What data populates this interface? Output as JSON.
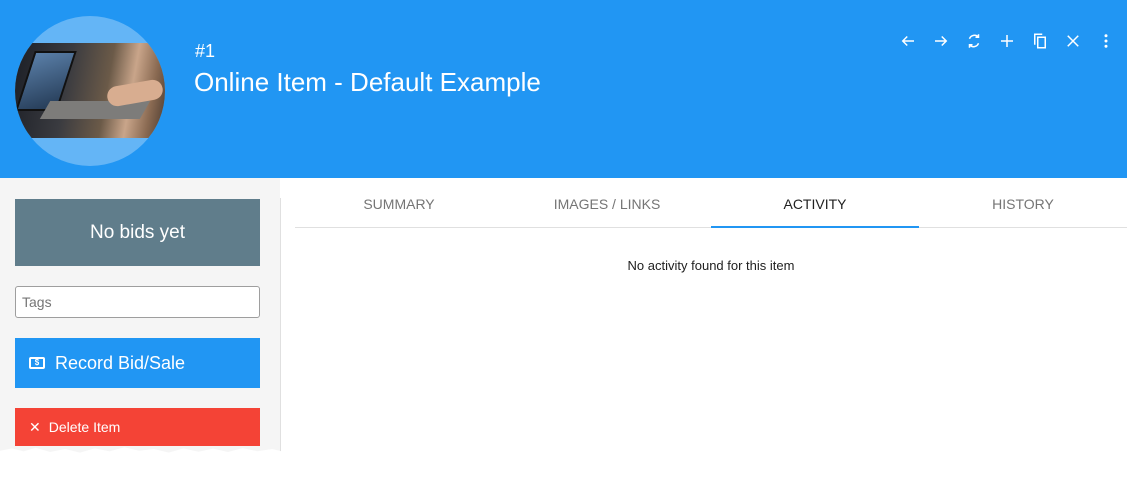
{
  "header": {
    "item_number": "#1",
    "title": "Online Item - Default Example",
    "background_color": "#2196F3",
    "actions": [
      {
        "icon": "arrow-left-icon"
      },
      {
        "icon": "arrow-right-icon"
      },
      {
        "icon": "refresh-icon"
      },
      {
        "icon": "add-icon"
      },
      {
        "icon": "copy-icon"
      },
      {
        "icon": "close-icon"
      },
      {
        "icon": "more-vert-icon"
      }
    ]
  },
  "sidebar": {
    "bids_status": "No bids yet",
    "bids_color": "#607D8B",
    "tags_placeholder": "Tags",
    "record_button_label": "Record Bid/Sale",
    "record_button_color": "#2196F3",
    "delete_button_label": "Delete Item",
    "delete_button_color": "#F44336"
  },
  "tabs": [
    {
      "label": "SUMMARY",
      "active": false
    },
    {
      "label": "IMAGES / LINKS",
      "active": false
    },
    {
      "label": "ACTIVITY",
      "active": true
    },
    {
      "label": "HISTORY",
      "active": false
    }
  ],
  "content": {
    "empty_message": "No activity found for this item"
  }
}
